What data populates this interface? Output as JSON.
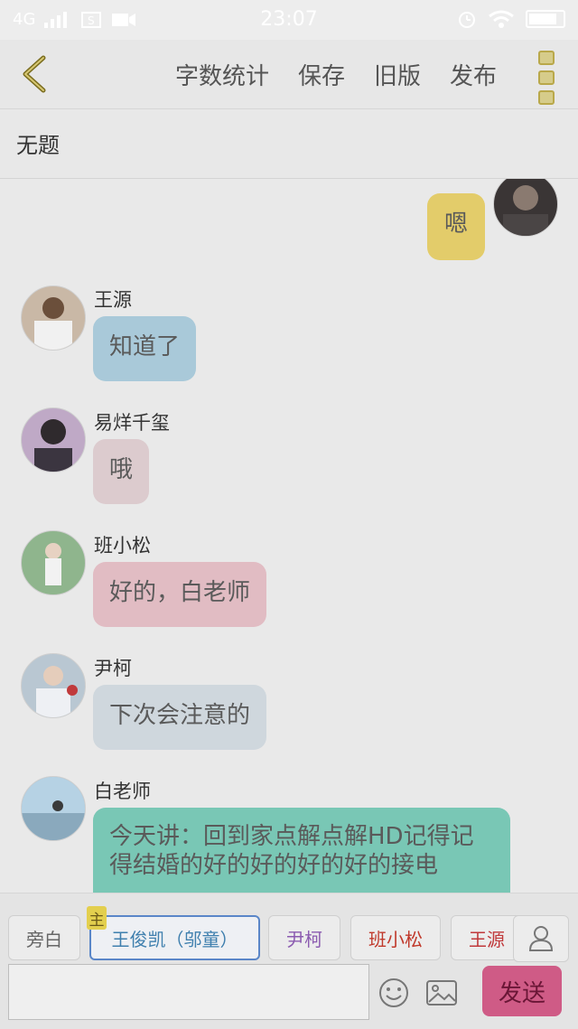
{
  "status_bar": {
    "network": "4G",
    "time": "23:07"
  },
  "toolbar": {
    "actions": [
      "字数统计",
      "保存",
      "旧版",
      "发布"
    ]
  },
  "title": "无题",
  "messages": [
    {
      "sender": "",
      "text": "嗯",
      "side": "right",
      "bubble_color": "#e3cc6a"
    },
    {
      "sender": "王源",
      "text": "知道了",
      "side": "left",
      "bubble_color": "#a9c9d9"
    },
    {
      "sender": "易烊千玺",
      "text": "哦",
      "side": "left",
      "bubble_color": "#dccbce"
    },
    {
      "sender": "班小松",
      "text": "好的，白老师",
      "side": "left",
      "bubble_color": "#e1bcc3"
    },
    {
      "sender": "尹柯",
      "text": "下次会注意的",
      "side": "left",
      "bubble_color": "#cfd7dd"
    },
    {
      "sender": "白老师",
      "text": "今天讲：回到家点解点解HD记得记得结婚的好的好的好的好的接电",
      "side": "left",
      "bubble_color": "#79c7b5"
    }
  ],
  "roles": [
    {
      "label": "旁白",
      "color": "#666666"
    },
    {
      "label": "王俊凯（邬童）",
      "color": "#3f7fae",
      "selected": true,
      "badge": "主"
    },
    {
      "label": "尹柯",
      "color": "#8b5bb0"
    },
    {
      "label": "班小松",
      "color": "#c0392b"
    },
    {
      "label": "王源",
      "color": "#c0393b"
    }
  ],
  "composer": {
    "input_value": "",
    "send_label": "发送"
  },
  "colors": {
    "accent": "#cf5b86",
    "more_icon": "#d6cc8a"
  }
}
